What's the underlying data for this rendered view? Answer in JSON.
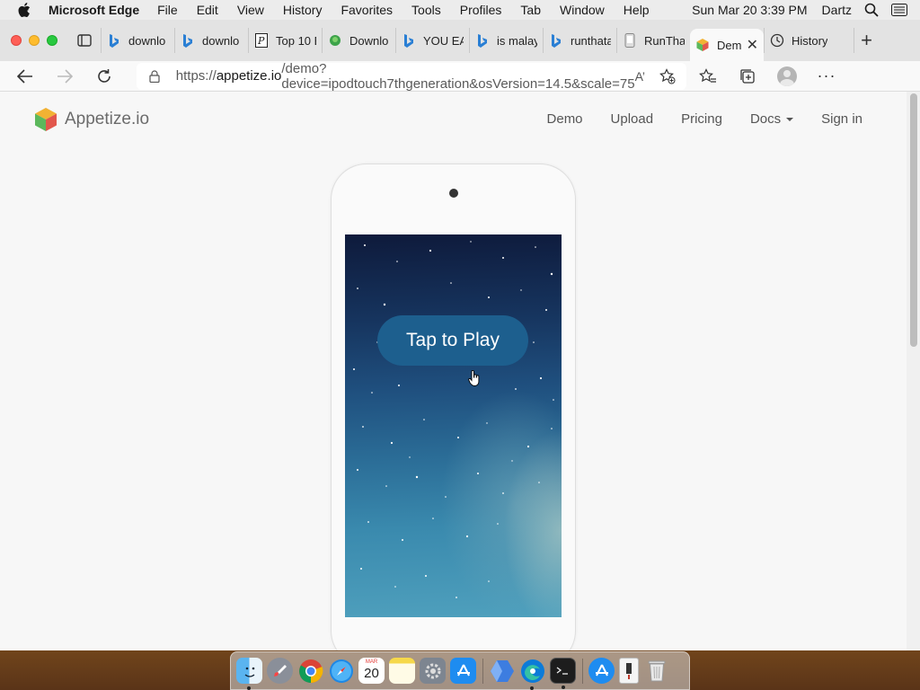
{
  "menubar": {
    "app_name": "Microsoft Edge",
    "items": [
      "File",
      "Edit",
      "View",
      "History",
      "Favorites",
      "Tools",
      "Profiles",
      "Tab",
      "Window",
      "Help"
    ],
    "clock": "Sun Mar 20  3:39 PM",
    "user": "Dartz"
  },
  "tabs": [
    {
      "title": "downlo",
      "icon": "bing-icon"
    },
    {
      "title": "downlo",
      "icon": "bing-icon"
    },
    {
      "title": "Top 10 E",
      "icon": "page-icon"
    },
    {
      "title": "Downlo",
      "icon": "download-site-icon"
    },
    {
      "title": "YOU EA",
      "icon": "bing-icon"
    },
    {
      "title": "is malay",
      "icon": "bing-icon"
    },
    {
      "title": "runthata",
      "icon": "bing-icon"
    },
    {
      "title": "RunThat",
      "icon": "runthat-icon"
    },
    {
      "title": "Dem",
      "icon": "appetize-icon",
      "active": true
    },
    {
      "title": "History",
      "icon": "history-icon"
    }
  ],
  "address": {
    "prefix": "https://",
    "domain": "appetize.io",
    "path": "/demo?device=ipodtouch7thgeneration&osVersion=14.5&scale=75",
    "read_aloud": "A’"
  },
  "site": {
    "logo_text": "Appetize.io",
    "nav": [
      "Demo",
      "Upload",
      "Pricing",
      "Docs",
      "Sign in"
    ]
  },
  "device": {
    "play_button": "Tap to Play"
  },
  "dock": {
    "calendar_day": "20",
    "calendar_month": "MAR"
  },
  "colors": {
    "accent_blue": "#1d5f8e",
    "tab_bar": "#e3e3e3",
    "page_bg": "#f7f7f7"
  }
}
